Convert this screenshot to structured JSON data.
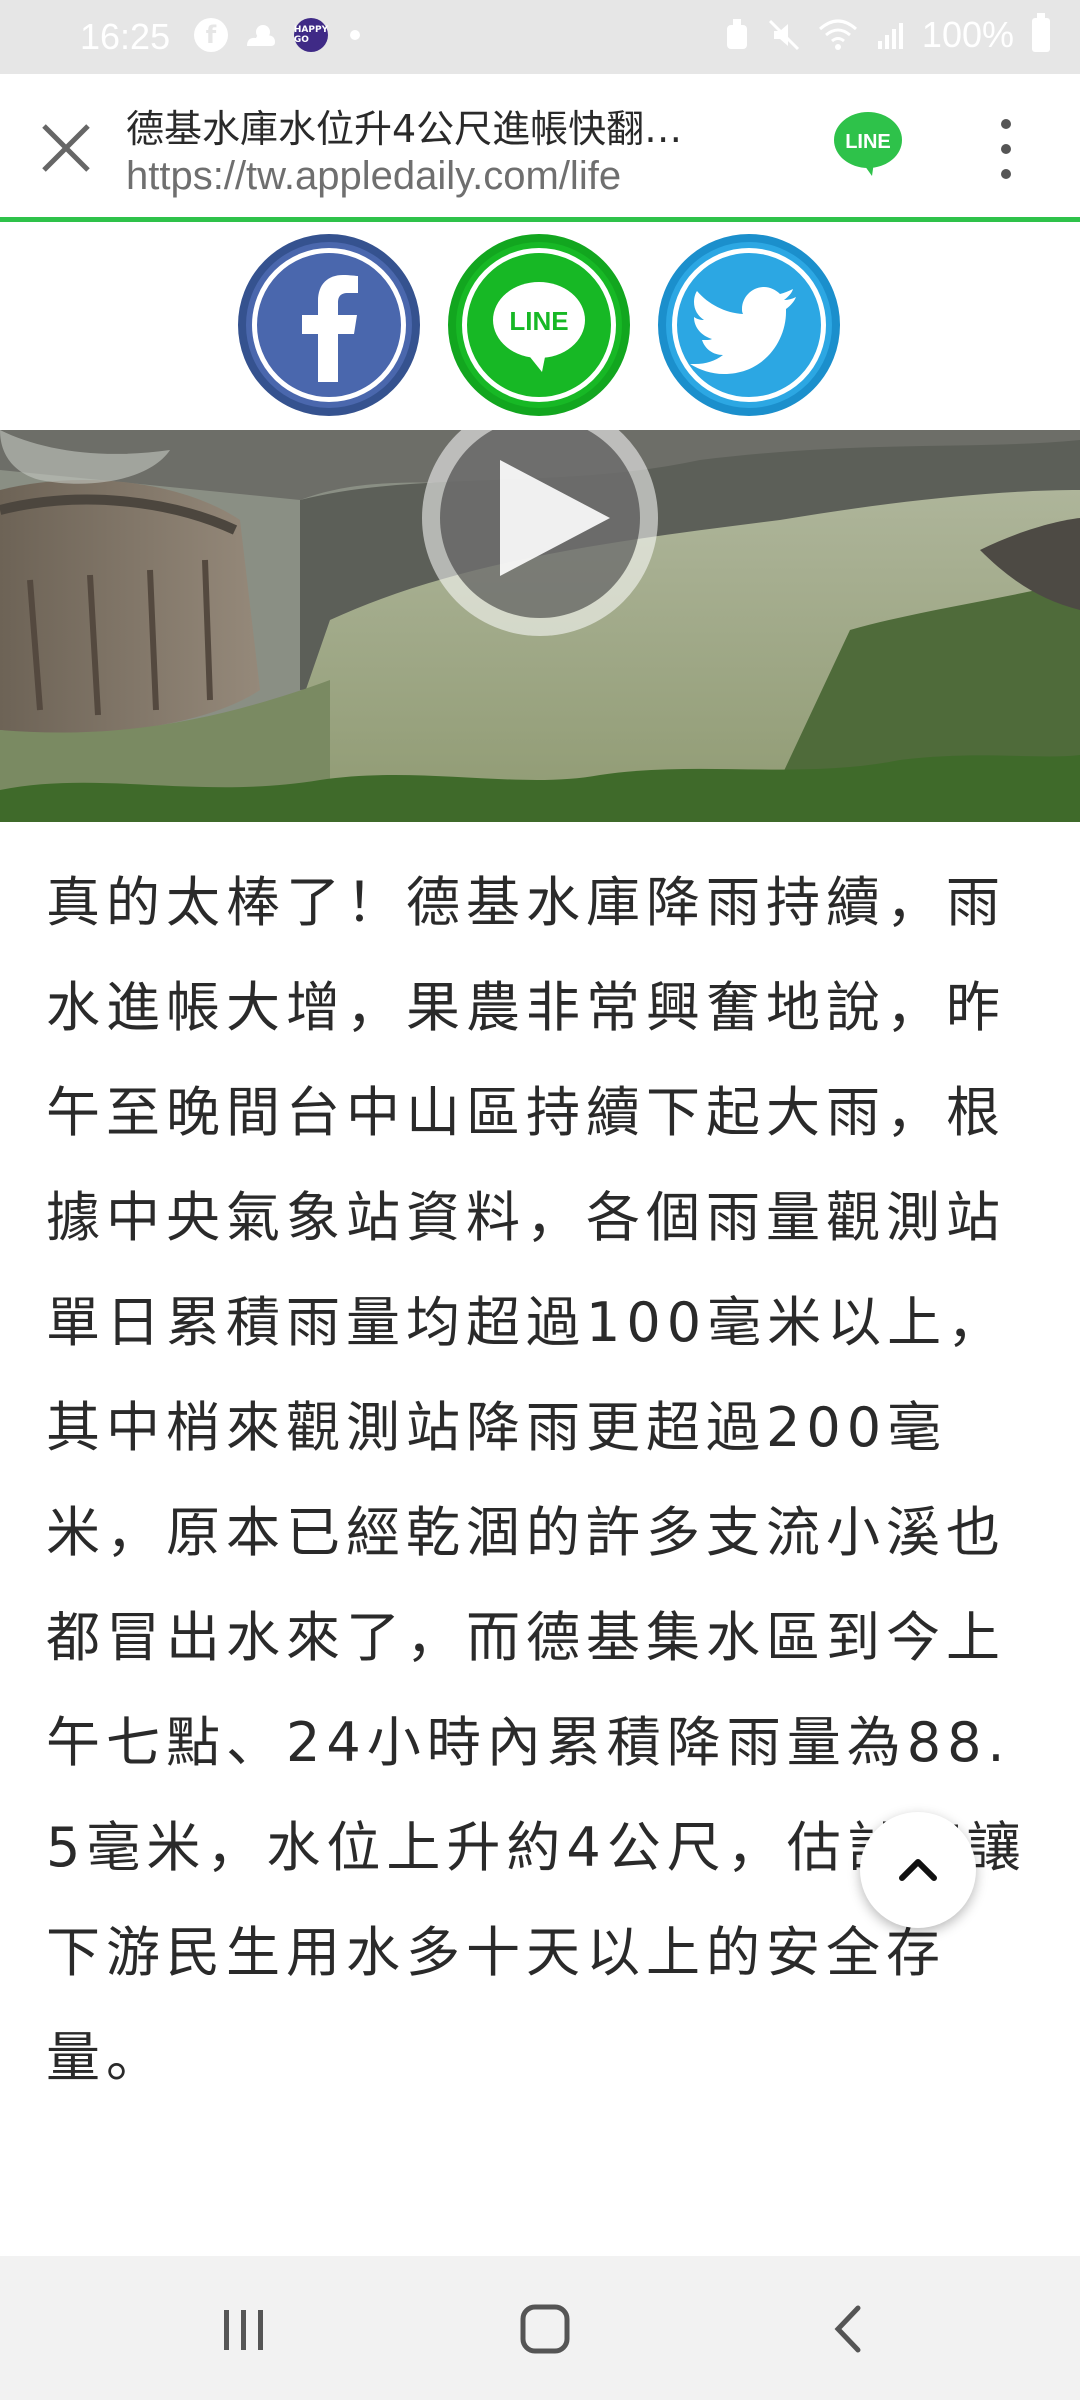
{
  "status_bar": {
    "time": "16:25",
    "battery_text": "100%",
    "icons": [
      "facebook-notification-icon",
      "weather-icon",
      "happygo-app-icon",
      "dot-icon",
      "alarm-icon",
      "mute-icon",
      "wifi-icon",
      "signal-icon",
      "battery-icon"
    ],
    "happygo_label": "HAPPY GO"
  },
  "browser": {
    "page_title": "德基水庫水位升4公尺進帳快翻…",
    "url": "https://tw.appledaily.com/life",
    "line_logo_text": "LINE",
    "accent_color": "#2ec24a"
  },
  "share": {
    "buttons": [
      {
        "name": "facebook",
        "color": "#4a67ad"
      },
      {
        "name": "line",
        "color": "#17b825",
        "text": "LINE"
      },
      {
        "name": "twitter",
        "color": "#2ca7e3"
      }
    ]
  },
  "video": {
    "icon": "play-icon"
  },
  "article": {
    "paragraph": "真的太棒了！德基水庫降雨持續，雨水進帳大增，果農非常興奮地說，昨午至晚間台中山區持續下起大雨，根據中央氣象站資料，各個雨量觀測站單日累積雨量均超過100毫米以上，其中梢來觀測站降雨更超過200毫米，原本已經乾涸的許多支流小溪也都冒出水來了，而德基集水區到今上午七點、24小時內累積降雨量為88.5毫米，水位上升約4公尺，估計可讓下游民生用水多十天以上的安全存量。"
  },
  "nav": {
    "icons": [
      "recent-apps-icon",
      "home-icon",
      "back-icon"
    ]
  }
}
